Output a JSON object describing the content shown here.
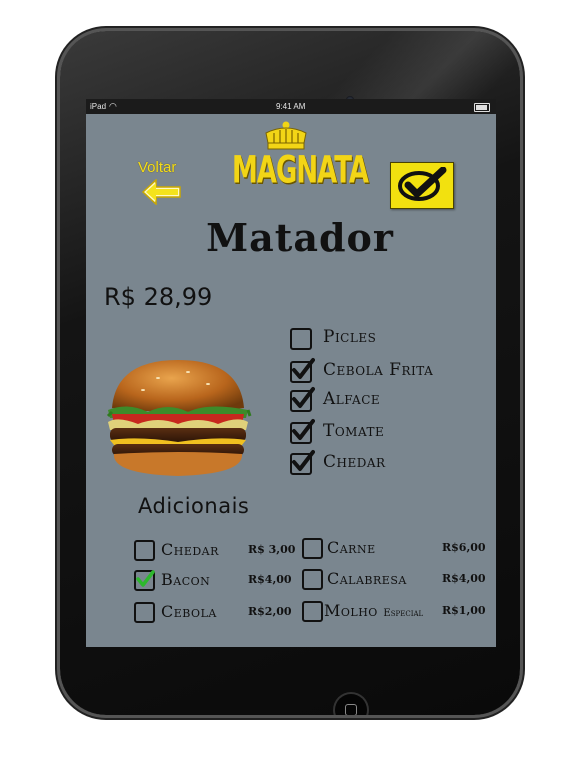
{
  "status_bar": {
    "carrier": "iPad",
    "time": "9:41 AM"
  },
  "header": {
    "back_label": "Voltar",
    "logo_text": "MAGNATA"
  },
  "product": {
    "name": "Matador",
    "price": "R$ 28,99"
  },
  "ingredients": [
    {
      "label": "Picles",
      "checked": false
    },
    {
      "label": "Cebola Frita",
      "checked": true
    },
    {
      "label": "Alface",
      "checked": true
    },
    {
      "label": "Tomate",
      "checked": true
    },
    {
      "label": "Chedar",
      "checked": true
    }
  ],
  "addons_title": "Adicionais",
  "addons": [
    {
      "label": "Chedar",
      "price": "R$ 3,00",
      "checked": false
    },
    {
      "label": "Bacon",
      "price": "R$4,00",
      "checked": true
    },
    {
      "label": "Cebola",
      "price": "R$2,00",
      "checked": false
    },
    {
      "label": "Carne",
      "price": "R$6,00",
      "checked": false
    },
    {
      "label": "Calabresa",
      "price": "R$4,00",
      "checked": false
    },
    {
      "label": "Molho",
      "label_suffix": "Especial",
      "price": "R$1,00",
      "checked": false
    }
  ],
  "colors": {
    "screen_bg": "#7a868f",
    "accent_yellow": "#f2e10f",
    "checkbox_green": "#2db82d"
  }
}
